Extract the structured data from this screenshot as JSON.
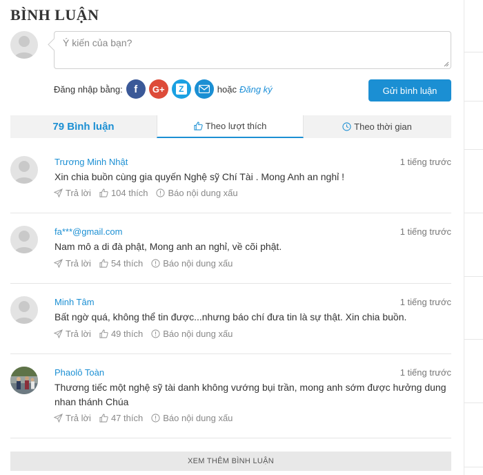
{
  "header": {
    "title": "BÌNH LUẬN"
  },
  "compose": {
    "placeholder": "Ý kiến của bạn?",
    "login_label": "Đăng nhập bằng:",
    "or_label": "hoặc",
    "register_label": "Đăng ký",
    "send_label": "Gửi bình luận",
    "social": [
      {
        "name": "facebook",
        "icon": "facebook-icon",
        "glyph": "f",
        "color": "#3b5998"
      },
      {
        "name": "google-plus",
        "icon": "google-plus-icon",
        "glyph": "G+",
        "color": "#dd4b39"
      },
      {
        "name": "zalo",
        "icon": "zalo-icon",
        "glyph": "Z",
        "color": "#1ba1e2"
      },
      {
        "name": "email",
        "icon": "email-icon",
        "glyph": "",
        "color": "#1b8fd3"
      }
    ]
  },
  "tabs": {
    "count_label": "79 Bình luận",
    "by_likes": "Theo lượt thích",
    "by_time": "Theo thời gian"
  },
  "comments": [
    {
      "author": "Trương Minh Nhật",
      "time": "1 tiếng trước",
      "text": "Xin chia buồn cùng gia quyến Nghệ sỹ Chí Tài . Mong Anh an nghỉ !",
      "reply": "Trả lời",
      "likes": "104 thích",
      "report": "Báo nội dung xấu"
    },
    {
      "author": "fa***@gmail.com",
      "time": "1 tiếng trước",
      "text": "Nam mô a di đà phật, Mong anh an nghỉ, về cõi phật.",
      "reply": "Trả lời",
      "likes": "54 thích",
      "report": "Báo nội dung xấu"
    },
    {
      "author": "Minh Tâm",
      "time": "1 tiếng trước",
      "text": "Bất ngờ quá, không thể tin được...nhưng báo chí đưa tin là sự thật. Xin chia buồn.",
      "reply": "Trả lời",
      "likes": "49 thích",
      "report": "Báo nội dung xấu"
    },
    {
      "author": "Phaolô Toàn",
      "time": "1 tiếng trước",
      "text": "Thương tiếc một nghệ sỹ tài danh không vướng bụi trần, mong anh sớm được hưởng dung nhan thánh Chúa",
      "reply": "Trả lời",
      "likes": "47 thích",
      "report": "Báo nội dung xấu"
    }
  ],
  "load_more": "XEM THÊM BÌNH LUẬN",
  "colors": {
    "accent": "#1b8fd3",
    "tab_bar": "#f2f2f2",
    "load_more_bg": "#e8e8e8"
  }
}
